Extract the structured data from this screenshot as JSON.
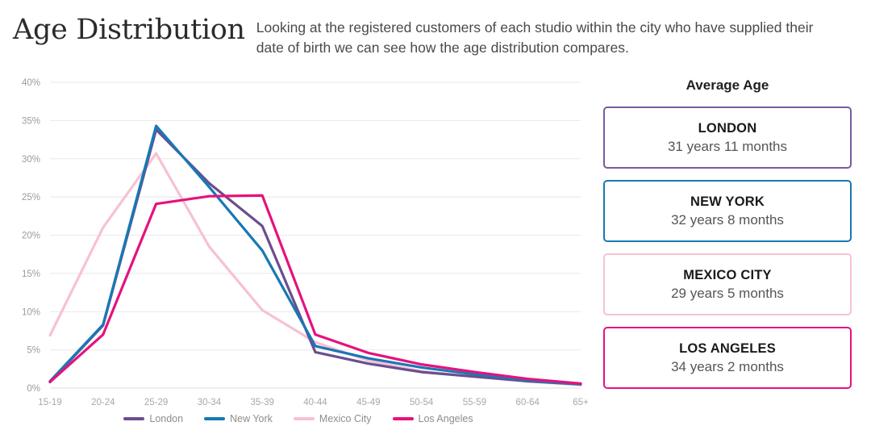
{
  "header": {
    "title": "Age Distribution",
    "subtitle": "Looking at the registered customers of each studio within the city who have supplied their date of birth we can see how the age distribution compares."
  },
  "side_panel": {
    "heading": "Average Age",
    "cards": [
      {
        "city": "LONDON",
        "age": "31 years 11 months",
        "color": "#7a5a9e"
      },
      {
        "city": "NEW YORK",
        "age": "32 years 8 months",
        "color": "#1878b4"
      },
      {
        "city": "MEXICO CITY",
        "age": "29 years 5 months",
        "color": "#f7c1d4"
      },
      {
        "city": "LOS ANGELES",
        "age": "34 years 2 months",
        "color": "#e5127d"
      }
    ]
  },
  "chart_data": {
    "type": "line",
    "title": "Age Distribution",
    "xlabel": "",
    "ylabel": "",
    "ylim": [
      0,
      40
    ],
    "ytick_labels": [
      "0%",
      "5%",
      "10%",
      "15%",
      "20%",
      "25%",
      "30%",
      "35%",
      "40%"
    ],
    "ytick_values": [
      0,
      5,
      10,
      15,
      20,
      25,
      30,
      35,
      40
    ],
    "grid": true,
    "legend_position": "bottom",
    "categories": [
      "15-19",
      "20-24",
      "25-29",
      "30-34",
      "35-39",
      "40-44",
      "45-49",
      "50-54",
      "55-59",
      "60-64",
      "65+"
    ],
    "series": [
      {
        "name": "London",
        "color": "#6b4e8e",
        "values": [
          0.8,
          8.2,
          33.8,
          26.8,
          21.2,
          4.7,
          3.2,
          2.1,
          1.5,
          0.9,
          0.5
        ]
      },
      {
        "name": "New York",
        "color": "#1878b4",
        "values": [
          0.9,
          8.3,
          34.3,
          26.3,
          18.0,
          5.5,
          3.9,
          2.7,
          1.8,
          1.0,
          0.5
        ]
      },
      {
        "name": "Mexico City",
        "color": "#f7c1d4",
        "values": [
          6.9,
          21.0,
          30.7,
          18.5,
          10.2,
          6.0,
          3.6,
          2.2,
          1.5,
          0.9,
          0.4
        ]
      },
      {
        "name": "Los Angeles",
        "color": "#e5127d",
        "values": [
          0.8,
          7.0,
          24.1,
          25.1,
          25.2,
          7.0,
          4.6,
          3.1,
          2.1,
          1.2,
          0.6
        ]
      }
    ]
  }
}
